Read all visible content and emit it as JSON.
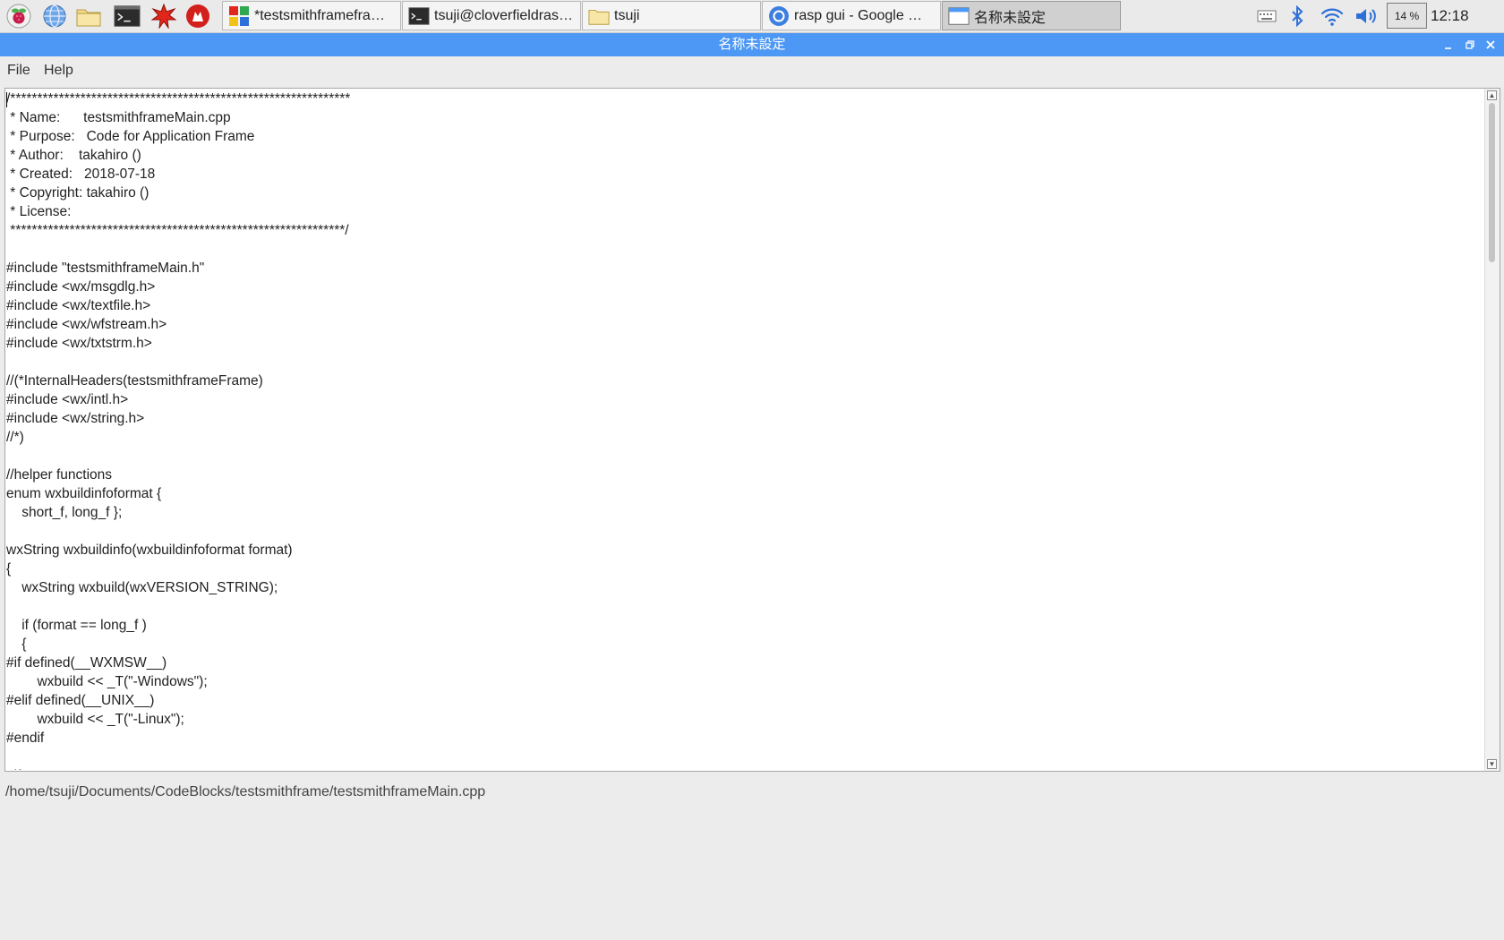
{
  "taskbar": {
    "launchers": [
      {
        "name": "raspberry-menu",
        "icon": "raspberry-icon"
      },
      {
        "name": "web-browser",
        "icon": "globe-icon"
      },
      {
        "name": "file-manager",
        "icon": "folder-icon"
      },
      {
        "name": "terminal",
        "icon": "terminal-icon"
      },
      {
        "name": "mathematica",
        "icon": "starburst-icon"
      },
      {
        "name": "wolfram",
        "icon": "wolf-icon"
      }
    ],
    "tasks": [
      {
        "label": "*testsmithframefram…",
        "icon": "codeblocks-icon",
        "active": false
      },
      {
        "label": "tsuji@cloverfieldrasp…",
        "icon": "terminal-icon",
        "active": false
      },
      {
        "label": "tsuji",
        "icon": "folder-icon",
        "active": false
      },
      {
        "label": "rasp gui - Google …",
        "icon": "chromium-icon",
        "active": false
      },
      {
        "label": "名称未設定",
        "icon": "window-icon",
        "active": true
      }
    ],
    "tray": {
      "cpu": "14 %",
      "clock": "12:18"
    }
  },
  "window": {
    "title": "名称未設定",
    "accent": "#4d98f5"
  },
  "menu": {
    "items": [
      "File",
      "Help"
    ]
  },
  "editor": {
    "lines": [
      "/***************************************************************",
      " * Name:      testsmithframeMain.cpp",
      " * Purpose:   Code for Application Frame",
      " * Author:    takahiro ()",
      " * Created:   2018-07-18",
      " * Copyright: takahiro ()",
      " * License:",
      " **************************************************************/",
      "",
      "#include \"testsmithframeMain.h\"",
      "#include <wx/msgdlg.h>",
      "#include <wx/textfile.h>",
      "#include <wx/wfstream.h>",
      "#include <wx/txtstrm.h>",
      "",
      "//(*InternalHeaders(testsmithframeFrame)",
      "#include <wx/intl.h>",
      "#include <wx/string.h>",
      "//*)",
      "",
      "//helper functions",
      "enum wxbuildinfoformat {",
      "    short_f, long_f };",
      "",
      "wxString wxbuildinfo(wxbuildinfoformat format)",
      "{",
      "    wxString wxbuild(wxVERSION_STRING);",
      "",
      "    if (format == long_f )",
      "    {",
      "#if defined(__WXMSW__)",
      "        wxbuild << _T(\"-Windows\");",
      "#elif defined(__UNIX__)",
      "        wxbuild << _T(\"-Linux\");",
      "#endif",
      "",
      "#if wxUSE_UNICODE"
    ]
  },
  "status": {
    "path": "/home/tsuji/Documents/CodeBlocks/testsmithframe/testsmithframeMain.cpp"
  }
}
